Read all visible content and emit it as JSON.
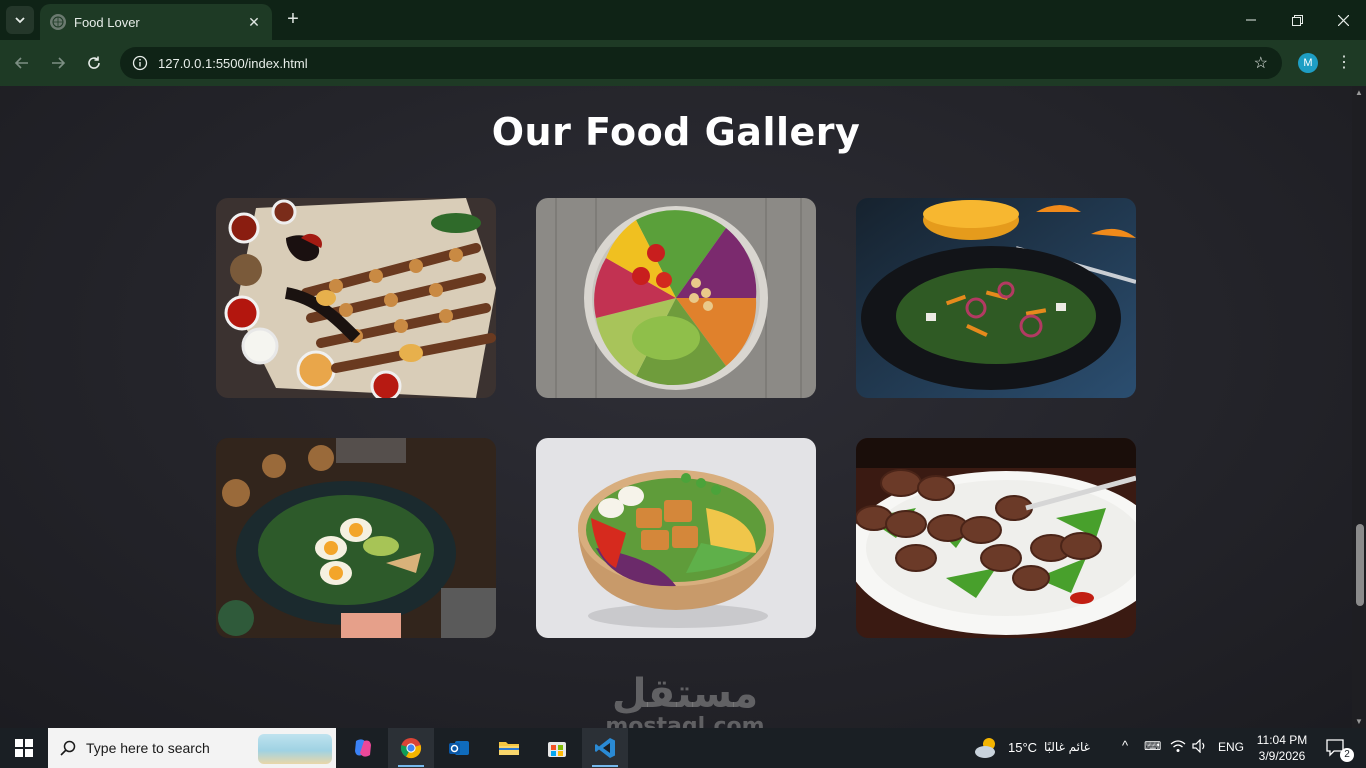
{
  "browser": {
    "tab_title": "Food Lover",
    "url": "127.0.0.1:5500/index.html",
    "profile_initial": "M"
  },
  "page": {
    "title": "Our Food Gallery",
    "gallery": [
      {
        "name": "grilled-kebab-platter"
      },
      {
        "name": "vegetable-salad-bowl"
      },
      {
        "name": "dark-plate-salad"
      },
      {
        "name": "egg-avocado-salad"
      },
      {
        "name": "chicken-salad-bowl"
      },
      {
        "name": "meatballs-plate"
      }
    ]
  },
  "watermark": {
    "arabic": "مستقل",
    "latin": "mostaql.com"
  },
  "taskbar": {
    "search_placeholder": "Type here to search",
    "weather_temp": "15°C",
    "weather_desc": "غائم غالبًا",
    "language": "ENG",
    "time": "11:04 PM",
    "date": "3/9/2026",
    "notifications": "2"
  }
}
